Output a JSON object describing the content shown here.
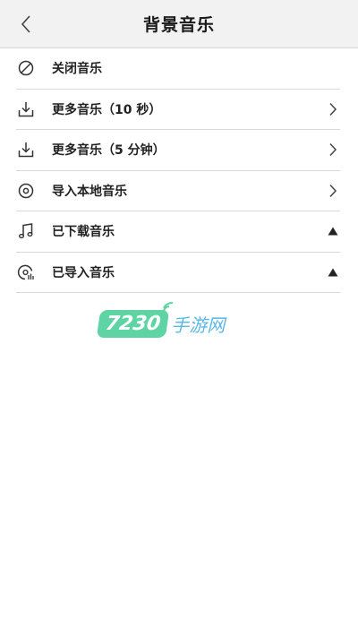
{
  "header": {
    "title": "背景音乐",
    "back_icon": "chevron-left-icon"
  },
  "items": [
    {
      "label": "关闭音乐",
      "icon": "no-entry-icon",
      "trail": ""
    },
    {
      "label": "更多音乐（10 秒）",
      "icon": "download-icon",
      "trail": "chevron-right-icon"
    },
    {
      "label": "更多音乐（5 分钟）",
      "icon": "download-icon",
      "trail": "chevron-right-icon"
    },
    {
      "label": "导入本地音乐",
      "icon": "disc-icon",
      "trail": "chevron-right-icon"
    },
    {
      "label": "已下载音乐",
      "icon": "music-note-icon",
      "trail": "triangle-up-icon"
    },
    {
      "label": "已导入音乐",
      "icon": "disc-bars-icon",
      "trail": "triangle-up-icon"
    }
  ],
  "watermark": {
    "badge": "7230",
    "text": "手游网"
  },
  "colors": {
    "header_bg": "#f2f2f2",
    "divider": "#d9d9d9",
    "watermark_green": "#5ed3a4",
    "watermark_blue": "#58b7e6"
  }
}
